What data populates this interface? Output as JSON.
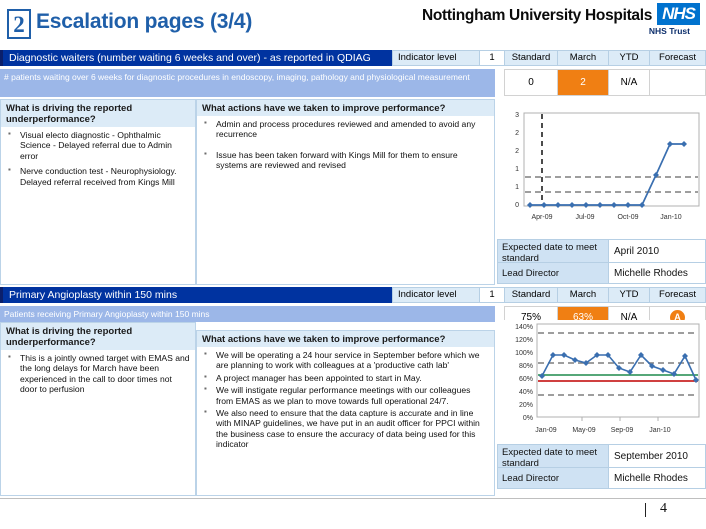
{
  "header": {
    "badge": "2",
    "title": "Escalation pages (3/4)",
    "trust_name": "Nottingham University Hospitals",
    "nhs_logo": "NHS",
    "nhs_sub": "NHS Trust"
  },
  "columns": {
    "indicator_level_label": "Indicator level",
    "standard": "Standard",
    "march": "March",
    "ytd": "YTD",
    "forecast": "Forecast"
  },
  "sections": [
    {
      "title": "Diagnostic waiters (number waiting 6 weeks and over) - as reported in QDIAG",
      "subtitle": "# patients waiting over 6 weeks for diagnostic procedures in endoscopy, imaging, pathology and physiological measurement",
      "indicator_level": "1",
      "values": {
        "standard": "0",
        "march": "2",
        "ytd": "N/A",
        "forecast": ""
      },
      "driver_heading": "What is driving the reported underperformance?",
      "drivers": [
        "Visual electo diagnostic - Ophthalmic Science - Delayed referral  due to Admin error",
        "Nerve conduction test - Neurophysiology. Delayed referral received from Kings Mill"
      ],
      "actions_heading": "What actions have we taken to improve performance?",
      "actions": [
        "Admin and process procedures reviewed and amended to avoid any recurrence",
        "Issue has been taken forward with Kings Mill for them to ensure systems are reviewed and revised"
      ],
      "expected_date_label": "Expected date to meet standard",
      "expected_date_value": "April 2010",
      "lead_director_label": "Lead Director",
      "lead_director_value": "Michelle Rhodes"
    },
    {
      "title": "Primary Angioplasty within 150 mins",
      "subtitle": "Patients receiving Primary Angioplasty within 150 mins",
      "indicator_level": "1",
      "values": {
        "standard": "75%",
        "march": "63%",
        "ytd": "N/A",
        "forecast": "A"
      },
      "driver_heading": "What is driving the reported underperformance?",
      "drivers": [
        "This is a jointly owned target with EMAS and the long delays for March have been experienced in the call to door times not door to perfusion"
      ],
      "actions_heading": "What actions have we taken to improve performance?",
      "actions": [
        "We will be operating a 24 hour service in September before which we are planning to work with colleagues at a 'productive cath lab'",
        "A project manager has been appointed to start in May.",
        "We will instigate regular performance meetings with our colleagues from EMAS as we plan to move towards full operational 24/7.",
        "We also need to ensure that the data capture is accurate and in line with MINAP guidelines, we have put in an audit officer for PPCI within the business case to ensure the accuracy of data being used for this indicator"
      ],
      "expected_date_label": "Expected date to meet standard",
      "expected_date_value": "September 2010",
      "lead_director_label": "Lead Director",
      "lead_director_value": "Michelle Rhodes"
    }
  ],
  "footer": {
    "separator": "|",
    "page_number": "4"
  },
  "colors": {
    "band_blue": "#0033A0",
    "sub_blue": "#9CB7E8",
    "amber": "#F07F13",
    "head_blue": "#DCEBF7",
    "series_blue": "#3A6FB0",
    "target_green": "#1F8A4C",
    "limit_red": "#C00000"
  },
  "chart_data": [
    {
      "type": "line",
      "title": "",
      "xlabel": "",
      "ylabel": "",
      "x": [
        "Apr-09",
        "May-09",
        "Jun-09",
        "Jul-09",
        "Aug-09",
        "Sep-09",
        "Oct-09",
        "Nov-09",
        "Dec-09",
        "Jan-10",
        "Feb-10",
        "Mar-10"
      ],
      "tick_labels": [
        "Apr-09",
        "Jul-09",
        "Oct-09",
        "Jan-10"
      ],
      "ytick_labels": [
        "0",
        "1",
        "1",
        "2",
        "2",
        "3"
      ],
      "ylim": [
        0,
        3
      ],
      "grid": false,
      "series": [
        {
          "name": "Number waiting over 6 weeks",
          "values": [
            0,
            0,
            0,
            0,
            0,
            0,
            0,
            0,
            0,
            1,
            2,
            2
          ]
        }
      ],
      "reference_lines": [
        {
          "name": "upper control limit",
          "value": 0.85,
          "style": "dashed",
          "color": "#808080"
        },
        {
          "name": "lower control limit",
          "value": 0.55,
          "style": "dashed",
          "color": "#808080"
        },
        {
          "name": "period marker",
          "value": "Apr-09",
          "orientation": "vertical",
          "style": "dashed",
          "color": "#000000"
        }
      ]
    },
    {
      "type": "line",
      "title": "",
      "xlabel": "",
      "ylabel": "",
      "x": [
        "Jan-09",
        "Feb-09",
        "Mar-09",
        "Apr-09",
        "May-09",
        "Jun-09",
        "Jul-09",
        "Aug-09",
        "Sep-09",
        "Oct-09",
        "Nov-09",
        "Dec-09",
        "Jan-10",
        "Feb-10",
        "Mar-10"
      ],
      "tick_labels": [
        "Jan-09",
        "May-09",
        "Sep-09",
        "Jan-10"
      ],
      "ytick_labels": [
        "0%",
        "20%",
        "40%",
        "60%",
        "80%",
        "100%",
        "120%",
        "140%"
      ],
      "ylim": [
        0,
        140
      ],
      "grid": false,
      "series": [
        {
          "name": "% within 150 mins",
          "values": [
            67,
            100,
            100,
            92,
            88,
            100,
            100,
            80,
            75,
            100,
            86,
            78,
            72,
            99,
            63
          ]
        }
      ],
      "reference_lines": [
        {
          "name": "upper control limit",
          "value": 127,
          "style": "dashed",
          "color": "#808080"
        },
        {
          "name": "mean upper",
          "value": 87,
          "style": "dashed",
          "color": "#808080"
        },
        {
          "name": "lower control limit",
          "value": 47,
          "style": "dashed",
          "color": "#808080"
        },
        {
          "name": "target",
          "value": 69,
          "style": "solid",
          "color": "#1F8A4C"
        },
        {
          "name": "standard",
          "value": 61,
          "style": "solid",
          "color": "#C00000"
        }
      ]
    }
  ]
}
